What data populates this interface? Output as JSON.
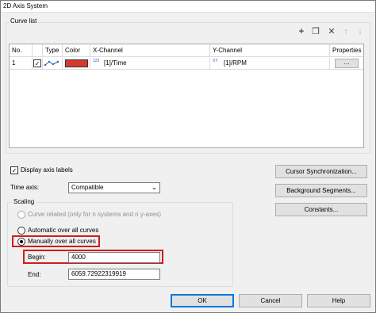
{
  "window": {
    "title": "2D Axis System"
  },
  "curve_list": {
    "title": "Curve list",
    "toolbar": [
      {
        "name": "add-icon",
        "glyph": "+"
      },
      {
        "name": "copy-icon",
        "glyph": "❐"
      },
      {
        "name": "delete-icon",
        "glyph": "✕"
      },
      {
        "name": "move-up-icon",
        "glyph": "↑"
      },
      {
        "name": "move-down-icon",
        "glyph": "↓"
      }
    ],
    "columns": [
      "No.",
      "Type",
      "Color",
      "X-Channel",
      "Y-Channel",
      "Properties"
    ],
    "rows": [
      {
        "no": "1",
        "checked": true,
        "color": "#d63a2f",
        "x_channel_badge": "123",
        "x_channel": "[1]/Time",
        "y_channel_badge": "XY",
        "y_channel": "[1]/RPM",
        "properties_button": "..."
      }
    ]
  },
  "display_axis_labels": {
    "label": "Display axis labels",
    "checked": true
  },
  "time_axis": {
    "label": "Time axis:",
    "value": "Compatible"
  },
  "scaling": {
    "title": "Scaling",
    "curve_related_label": "Curve related (only for n systems and n y-axes)",
    "automatic_label": "Automatic over all curves",
    "manual_label": "Manually over all curves",
    "begin_label": "Begin:",
    "begin_value": "4000",
    "end_label": "End:",
    "end_value": "6059.72922319919"
  },
  "side_buttons": {
    "cursor_sync": "Cursor Synchronization...",
    "background_segments": "Background Segments...",
    "constants": "Constants..."
  },
  "footer": {
    "ok": "OK",
    "cancel": "Cancel",
    "help": "Help"
  },
  "colors": {
    "highlight": "#d01c1c",
    "accent": "#0078d7"
  }
}
